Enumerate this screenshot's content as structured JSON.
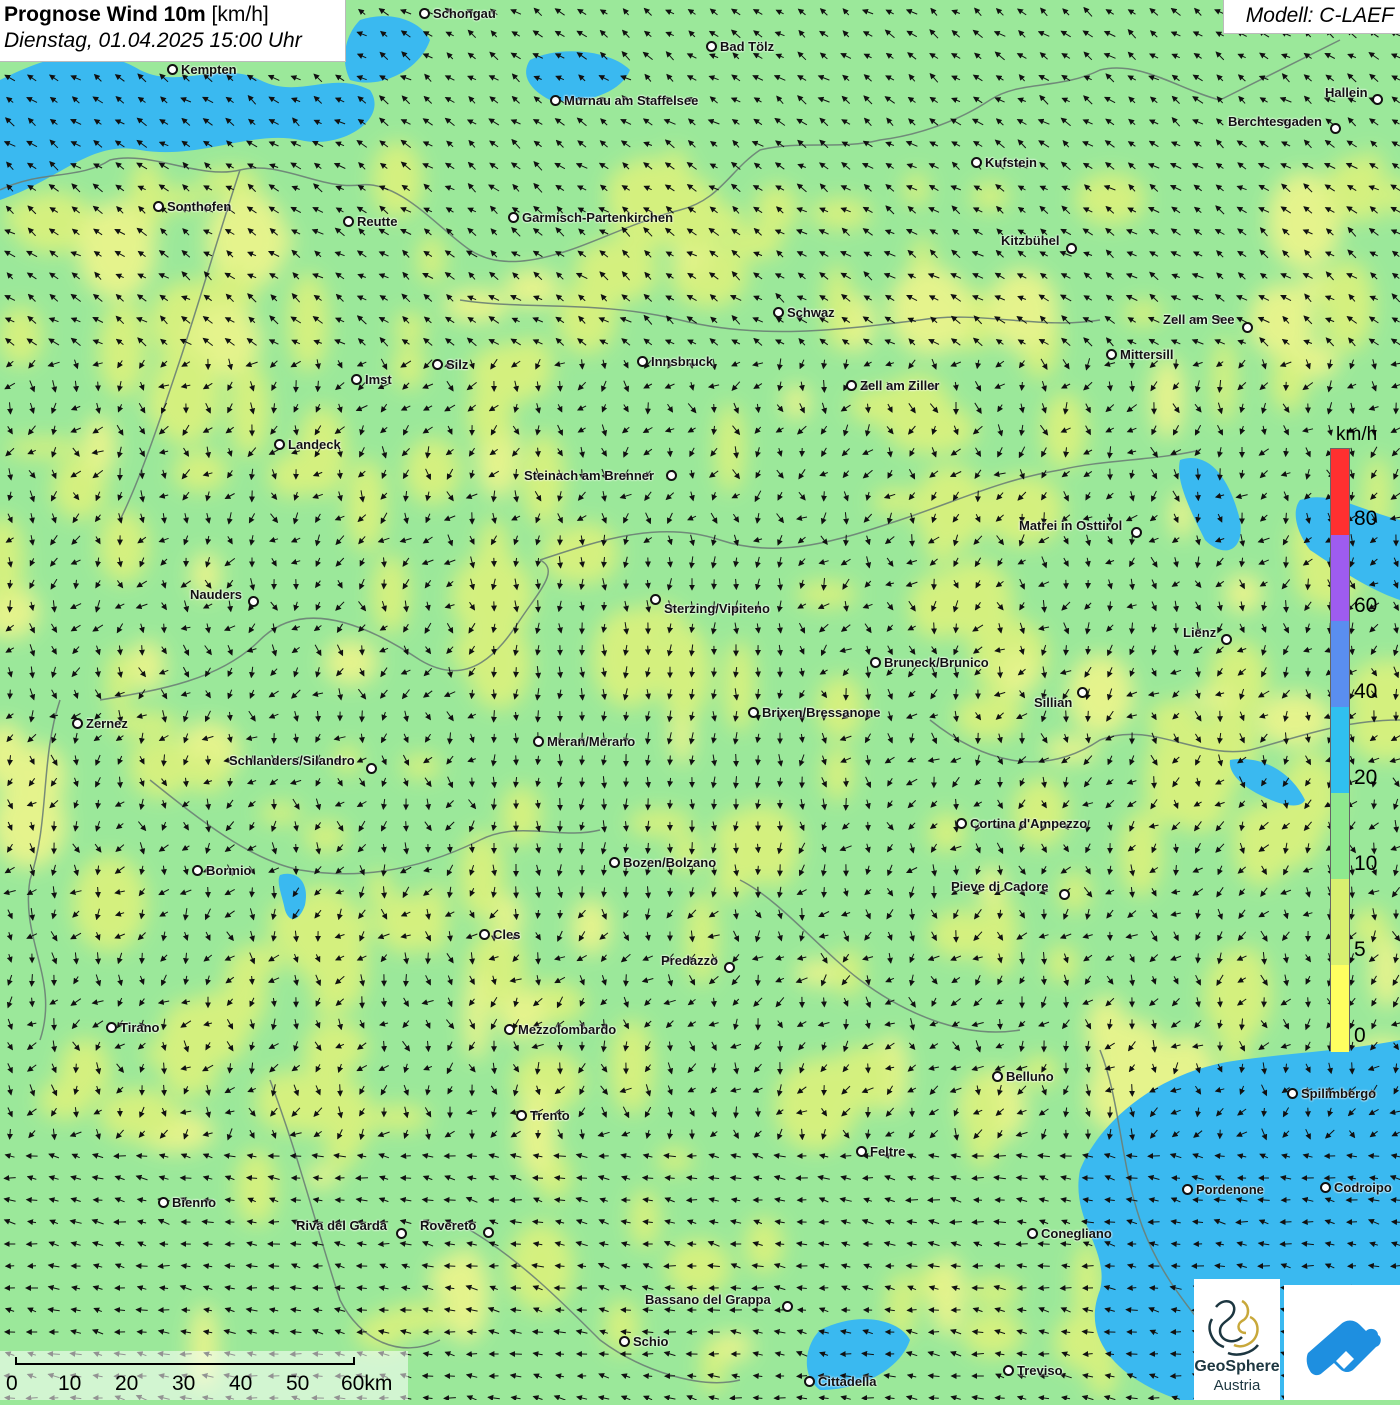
{
  "header": {
    "title_bold": "Prognose Wind 10m",
    "title_unit": "[km/h]",
    "datetime": "Dienstag, 01.04.2025 15:00 Uhr",
    "model": "Modell: C-LAEF"
  },
  "legend": {
    "unit": "km/h",
    "labels": [
      "80",
      "60",
      "40",
      "20",
      "10",
      "5",
      "0"
    ],
    "colors": [
      "#ff3030",
      "#9e5cf0",
      "#5a8ef0",
      "#30c0f0",
      "#8ee88e",
      "#d8f070",
      "#ffff60"
    ]
  },
  "scalebar": {
    "labels": [
      "0",
      "10",
      "20",
      "30",
      "40",
      "50",
      "60km"
    ]
  },
  "logos": {
    "geosphere_line1": "GeoSphere",
    "geosphere_line2": "Austria"
  },
  "cities": [
    {
      "name": "Schongau"
    },
    {
      "name": "Bad Tölz"
    },
    {
      "name": "Kempten"
    },
    {
      "name": "Murnau am Staffelsee"
    },
    {
      "name": "Hallein"
    },
    {
      "name": "Berchtesgaden"
    },
    {
      "name": "Kufstein"
    },
    {
      "name": "Sonthofen"
    },
    {
      "name": "Reutte"
    },
    {
      "name": "Garmisch-Partenkirchen"
    },
    {
      "name": "Kitzbühel"
    },
    {
      "name": "Schwaz"
    },
    {
      "name": "Zell am See"
    },
    {
      "name": "Mittersill"
    },
    {
      "name": "Innsbruck"
    },
    {
      "name": "Silz"
    },
    {
      "name": "Imst"
    },
    {
      "name": "Zell am Ziller"
    },
    {
      "name": "Landeck"
    },
    {
      "name": "Steinach am Brenner"
    },
    {
      "name": "Matrei in Osttirol"
    },
    {
      "name": "Nauders"
    },
    {
      "name": "Sterzing/Vipiteno"
    },
    {
      "name": "Lienz"
    },
    {
      "name": "Bruneck/Brunico"
    },
    {
      "name": "Sillian"
    },
    {
      "name": "Zernez"
    },
    {
      "name": "Brixen/Bressanone"
    },
    {
      "name": "Meran/Merano"
    },
    {
      "name": "Schlanders/Silandro"
    },
    {
      "name": "Cortina d'Ampezzo"
    },
    {
      "name": "Bozen/Bolzano"
    },
    {
      "name": "Bormio"
    },
    {
      "name": "Pieve di Cadore"
    },
    {
      "name": "Cles"
    },
    {
      "name": "Predazzo"
    },
    {
      "name": "Tirano"
    },
    {
      "name": "Mezzolombardo"
    },
    {
      "name": "Belluno"
    },
    {
      "name": "Spilimbergo"
    },
    {
      "name": "Trento"
    },
    {
      "name": "Feltre"
    },
    {
      "name": "Pordenone"
    },
    {
      "name": "Codroipo"
    },
    {
      "name": "Bienno"
    },
    {
      "name": "Riva del Garda"
    },
    {
      "name": "Rovereto"
    },
    {
      "name": "Conegliano"
    },
    {
      "name": "Bassano del Grappa"
    },
    {
      "name": "Schio"
    },
    {
      "name": "Treviso"
    },
    {
      "name": "Cittadella"
    }
  ]
}
